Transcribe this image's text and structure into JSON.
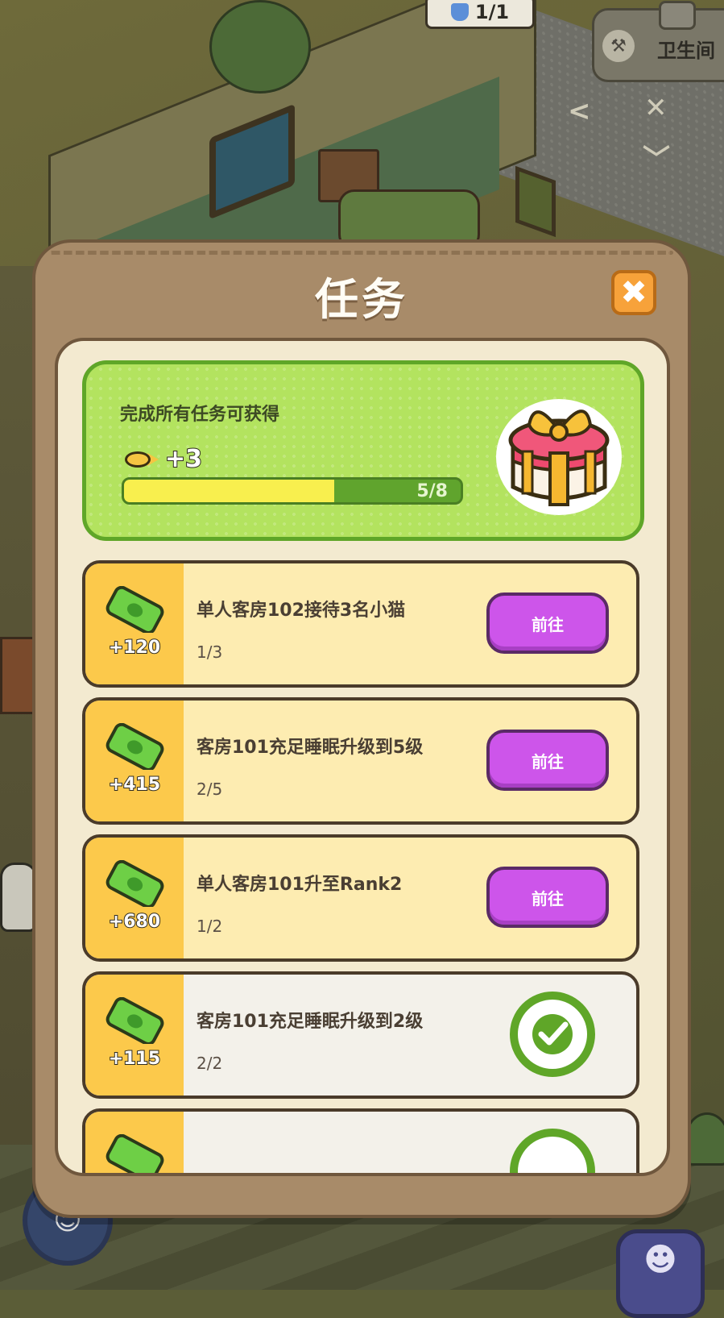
{
  "hud": {
    "count_text": "1/1",
    "location": "卫生间"
  },
  "modal": {
    "title": "任务",
    "close_icon": "close-x-icon",
    "reward": {
      "heading": "完成所有任务可获得",
      "bonus": "+3",
      "progress_text": "5/8",
      "progress_fraction": 0.625
    },
    "tasks": [
      {
        "amount": "+120",
        "desc": "单人客房102接待3名小猫",
        "progress": "1/3",
        "status": "go",
        "button": "前往"
      },
      {
        "amount": "+415",
        "desc": "客房101充足睡眠升级到5级",
        "progress": "2/5",
        "status": "go",
        "button": "前往"
      },
      {
        "amount": "+680",
        "desc": "单人客房101升至Rank2",
        "progress": "1/2",
        "status": "go",
        "button": "前往"
      },
      {
        "amount": "+115",
        "desc": "客房101充足睡眠升级到2级",
        "progress": "2/2",
        "status": "done",
        "button": ""
      }
    ]
  },
  "colors": {
    "panel": "#a88b69",
    "reward_card": "#b3e35f",
    "go_button": "#cd55ea",
    "check": "#5fa628"
  }
}
